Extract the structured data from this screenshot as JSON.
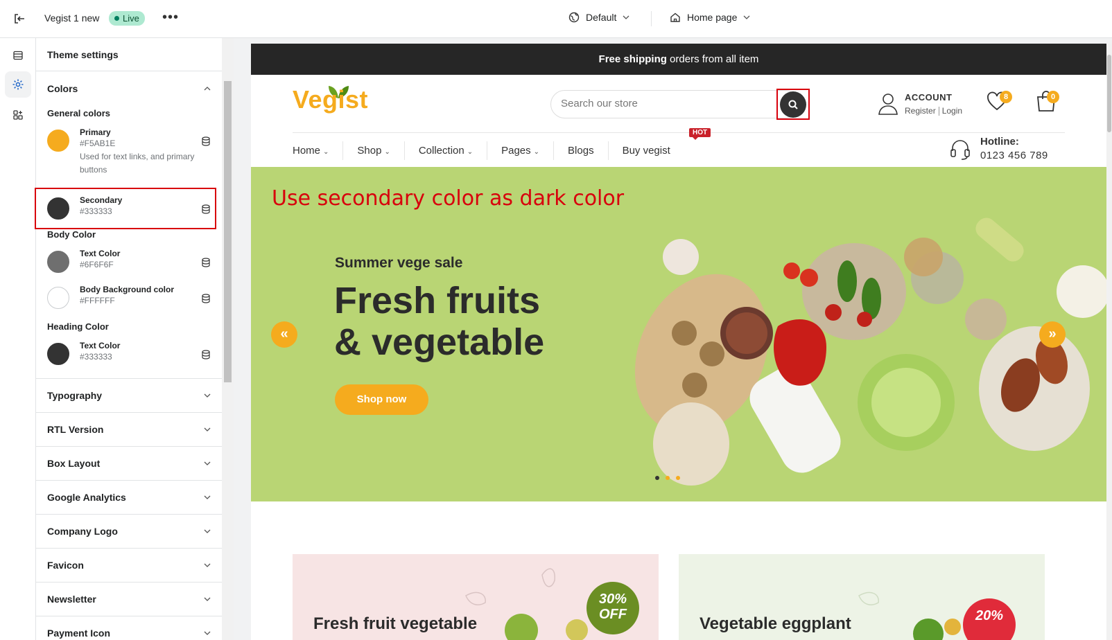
{
  "topbar": {
    "store_name": "Vegist 1 new",
    "live_label": "Live",
    "more_label": "•••",
    "theme_select": "Default",
    "page_select": "Home page"
  },
  "panel": {
    "title": "Theme settings",
    "colors": {
      "label": "Colors",
      "general_colors": "General colors",
      "primary": {
        "name": "Primary",
        "hex": "#F5AB1E",
        "desc": "Used for text links, and primary buttons",
        "color": "#F5AB1E"
      },
      "secondary": {
        "name": "Secondary",
        "hex": "#333333",
        "color": "#333333"
      },
      "body_color": "Body Color",
      "text": {
        "name": "Text Color",
        "hex": "#6F6F6F",
        "color": "#6F6F6F"
      },
      "body_bg": {
        "name": "Body Background color",
        "hex": "#FFFFFF",
        "color": "#FFFFFF"
      },
      "heading_color": "Heading Color",
      "heading_text": {
        "name": "Text Color",
        "hex": "#333333",
        "color": "#333333"
      }
    },
    "sections": [
      "Typography",
      "RTL Version",
      "Box Layout",
      "Google Analytics",
      "Company Logo",
      "Favicon",
      "Newsletter",
      "Payment Icon"
    ]
  },
  "preview": {
    "announcement_bold": "Free shipping",
    "announcement_rest": " orders from all item",
    "logo": "Vegist",
    "search_placeholder": "Search our store",
    "account_title": "ACCOUNT",
    "account_register": "Register",
    "account_login": "Login",
    "wishlist_count": "8",
    "cart_count": "0",
    "nav": [
      "Home",
      "Shop",
      "Collection",
      "Pages",
      "Blogs",
      "Buy vegist"
    ],
    "hot_badge": "HOT",
    "hotline_label": "Hotline:",
    "hotline_number": "0123 456 789",
    "annotation": "Use secondary color as dark color",
    "hero_sub": "Summer vege sale",
    "hero_line1": "Fresh fruits",
    "hero_line2": "& vegetable",
    "hero_button": "Shop now",
    "banner1_title": "Fresh fruit vegetable",
    "banner1_badge_line1": "30%",
    "banner1_badge_line2": "OFF",
    "banner2_title": "Vegetable eggplant",
    "banner2_badge": "20%",
    "colors": {
      "accent": "#F5AB1E",
      "dark": "#333333",
      "hero_bg": "#B9D574",
      "annotation": "#D8000C"
    }
  }
}
